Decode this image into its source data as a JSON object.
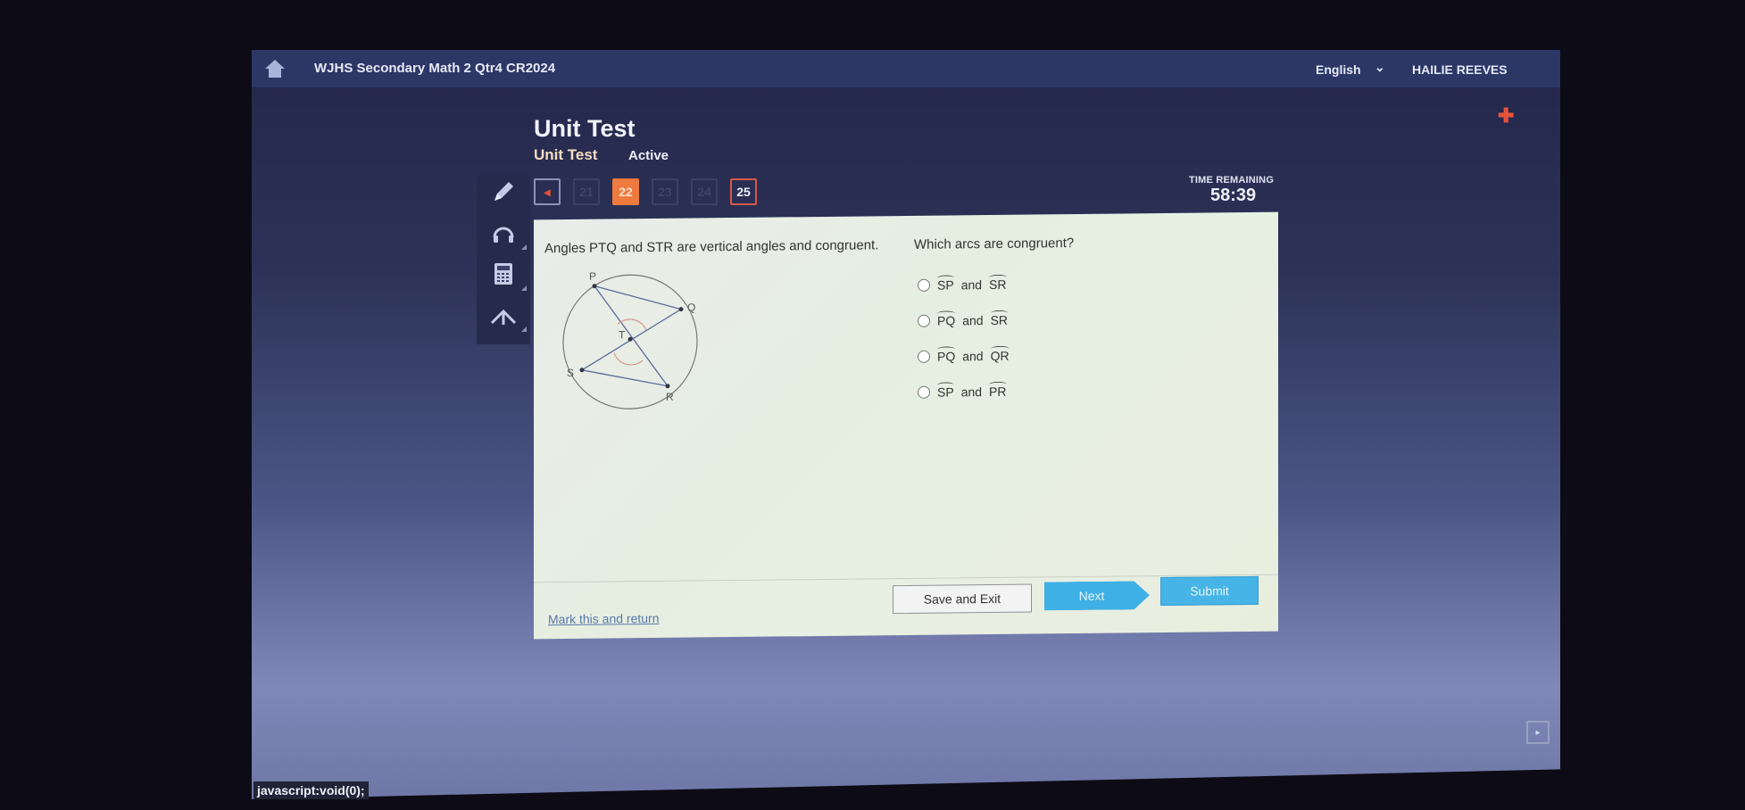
{
  "topbar": {
    "course_title": "WJHS Secondary Math 2 Qtr4 CR2024",
    "language": "English",
    "language_chevron": "⌄",
    "user_name": "HAILIE REEVES",
    "home_icon": "home-icon",
    "plus_icon": "✚"
  },
  "header": {
    "title": "Unit Test",
    "subtitle": "Unit Test",
    "status": "Active"
  },
  "tools": [
    "pencil-icon",
    "headphones-icon",
    "calculator-icon",
    "reference-icon"
  ],
  "pager": {
    "prev_label": "◂",
    "pages": [
      "21",
      "22",
      "23",
      "24",
      "25"
    ],
    "current": "22"
  },
  "timer": {
    "label": "TIME REMAINING",
    "value": "58:39"
  },
  "question": {
    "statement": "Angles PTQ and STR are vertical angles and congruent.",
    "prompt": "Which arcs are congruent?",
    "diagram_labels": {
      "P": "P",
      "Q": "Q",
      "T": "T",
      "S": "S",
      "R": "R"
    },
    "options": [
      {
        "a": "SP",
        "mid": "and",
        "b": "SR"
      },
      {
        "a": "PQ",
        "mid": "and",
        "b": "SR"
      },
      {
        "a": "PQ",
        "mid": "and",
        "b": "QR"
      },
      {
        "a": "SP",
        "mid": "and",
        "b": "PR"
      }
    ]
  },
  "footer": {
    "mark_link": "Mark this and return",
    "save_exit": "Save and Exit",
    "next": "Next",
    "submit": "Submit"
  },
  "next_page_arrow": "▸",
  "status_bar": "javascript:void(0);",
  "colors": {
    "topbar": "#2c3766",
    "active_page": "#ef7a3e",
    "accent_blue": "#3fb0e6",
    "alert_red": "#e5533a"
  }
}
